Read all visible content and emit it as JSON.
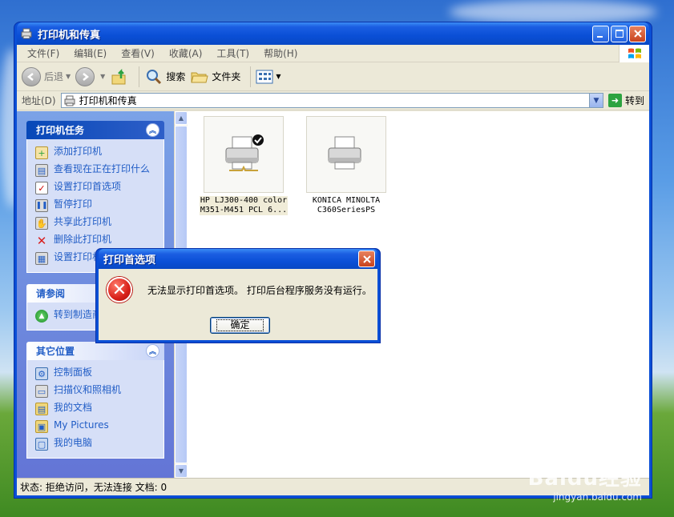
{
  "window": {
    "title": "打印机和传真"
  },
  "menu": [
    "文件(F)",
    "编辑(E)",
    "查看(V)",
    "收藏(A)",
    "工具(T)",
    "帮助(H)"
  ],
  "toolbar": {
    "back": "后退",
    "search": "搜索",
    "folders": "文件夹"
  },
  "address": {
    "label": "地址(D)",
    "value": "打印机和传真",
    "go": "转到"
  },
  "panels": {
    "printer_tasks": {
      "title": "打印机任务",
      "items": [
        "添加打印机",
        "查看现在正在打印什么",
        "设置打印首选项",
        "暂停打印",
        "共享此打印机",
        "删除此打印机",
        "设置打印机属性"
      ]
    },
    "see_also": {
      "title": "请参阅",
      "items": [
        "转到制造商的网站"
      ]
    },
    "other_places": {
      "title": "其它位置",
      "items": [
        "控制面板",
        "扫描仪和照相机",
        "我的文档",
        "My Pictures",
        "我的电脑"
      ]
    }
  },
  "printers": [
    {
      "line1": "HP LJ300-400 color",
      "line2": "M351-M451 PCL 6...",
      "default": true
    },
    {
      "line1": "KONICA MINOLTA",
      "line2": "C360SeriesPS",
      "default": false
    }
  ],
  "status": "状态: 拒绝访问，无法连接 文档: 0",
  "dialog": {
    "title": "打印首选项",
    "message": "无法显示打印首选项。 打印后台程序服务没有运行。",
    "ok": "确定"
  },
  "watermark": {
    "big": "Baidu经验",
    "small": "jingyan.baidu.com"
  }
}
